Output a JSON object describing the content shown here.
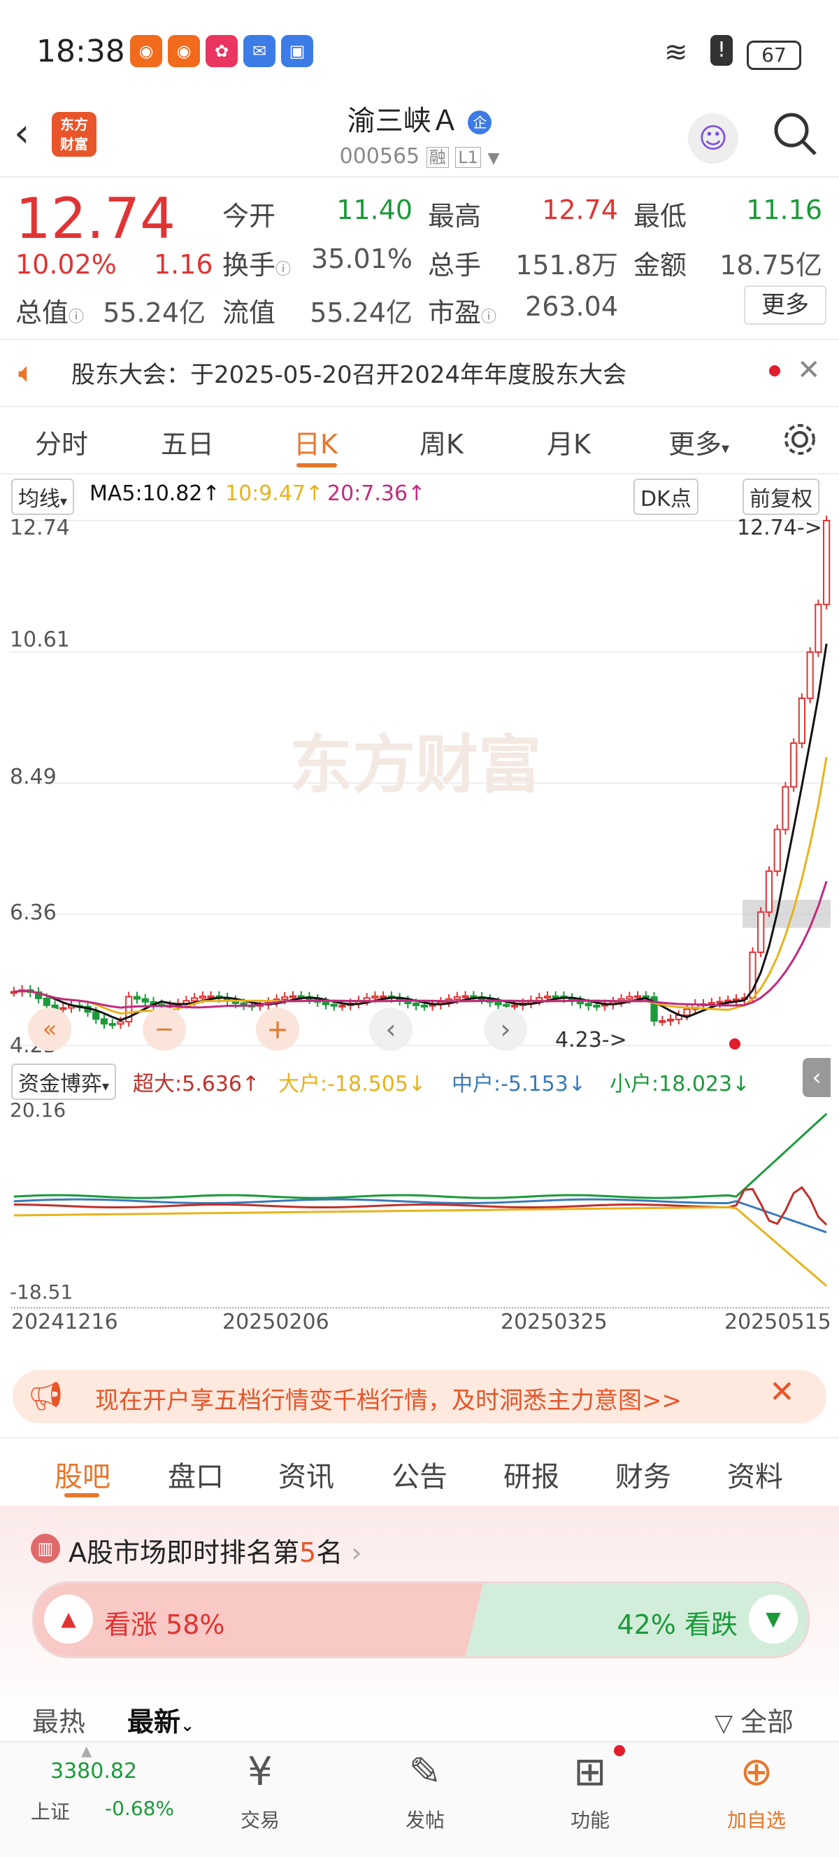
{
  "status": {
    "time": "18:38",
    "battery": "67"
  },
  "header": {
    "title": "渝三峡Ａ",
    "code": "000565",
    "tag1": "融",
    "tag2": "L1",
    "logo_line1": "东方",
    "logo_line2": "财富"
  },
  "quote": {
    "price": "12.74",
    "pct": "10.02%",
    "change": "1.16",
    "row1": [
      {
        "label": "今开",
        "value": "11.40"
      },
      {
        "label": "最高",
        "value": "12.74"
      },
      {
        "label": "最低",
        "value": "11.16"
      }
    ],
    "row2": [
      {
        "label": "换手",
        "value": "35.01%"
      },
      {
        "label": "总手",
        "value": "151.8万"
      },
      {
        "label": "金额",
        "value": "18.75亿"
      }
    ],
    "row3": [
      {
        "label": "总值",
        "value": "55.24亿"
      },
      {
        "label": "流值",
        "value": "55.24亿"
      },
      {
        "label": "市盈",
        "value": "263.04"
      }
    ],
    "more": "更多"
  },
  "notice": {
    "text": "股东大会：于2025-05-20召开2024年年度股东大会"
  },
  "tabs": [
    "分时",
    "五日",
    "日K",
    "周K",
    "月K",
    "更多",
    "设置"
  ],
  "chart": {
    "ma_select": "均线",
    "ma5": "MA5:10.82↑",
    "ma10": "10:9.47↑",
    "ma20": "20:7.36↑",
    "dk": "DK点",
    "fq": "前复权",
    "y_ticks": [
      "12.74",
      "10.61",
      "8.49",
      "6.36",
      "4.23"
    ],
    "high_label": "12.74->",
    "low_label": "4.23->",
    "watermark": "东方财富",
    "flow_select": "资金博弈",
    "flow_super": "超大:5.636↑",
    "flow_big": "大户:-18.505↓",
    "flow_mid": "中户:-5.153↓",
    "flow_small": "小户:18.023↓",
    "flow_top": "20.16",
    "flow_bottom": "-18.51",
    "dates": [
      "20241216",
      "20250206",
      "20250325",
      "20250515"
    ],
    "colors": {
      "up": "#e03434",
      "down": "#1a9a3a",
      "ma5": "#111111",
      "ma10": "#e8b21c",
      "ma20": "#c02a80"
    }
  },
  "ad": {
    "text": "现在开户享五档行情变千档行情，及时洞悉主力意图>>"
  },
  "bottom_tabs": [
    "股吧",
    "盘口",
    "资讯",
    "公告",
    "研报",
    "财务",
    "资料"
  ],
  "rank": {
    "prefix": "A股市场即时排名第",
    "num": "5",
    "suffix": "名"
  },
  "vote": {
    "up_label": "看涨 58%",
    "down_label": "42% 看跌",
    "up_pct": 58
  },
  "sort": {
    "hot": "最热",
    "latest": "最新",
    "all": "全部"
  },
  "nav": {
    "index_value": "3380.82",
    "index_name": "上证",
    "index_change": "-0.68%",
    "items": [
      "交易",
      "发帖",
      "功能",
      "加自选"
    ]
  }
}
